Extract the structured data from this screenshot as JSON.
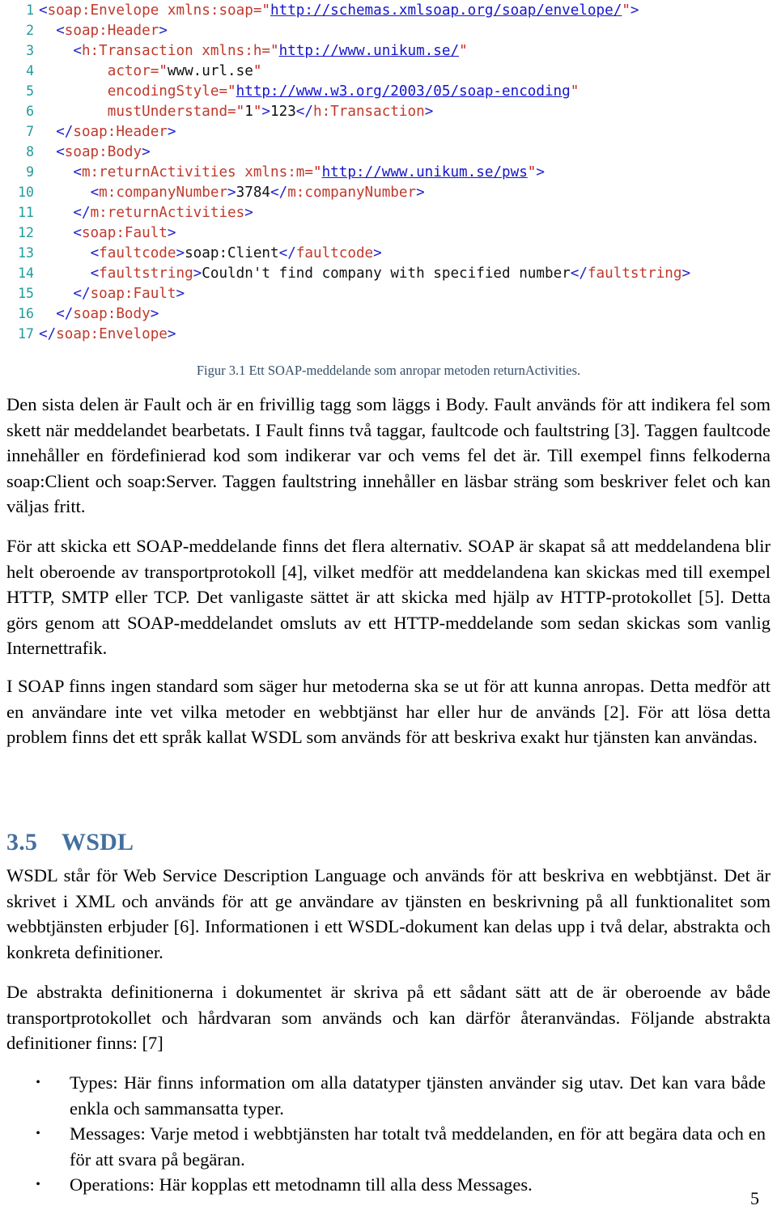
{
  "page": {
    "number": "5",
    "language": "sv"
  },
  "code_listing": {
    "name": "soap-message-example",
    "language": "xml",
    "lines": [
      {
        "n": "1",
        "indent": 0,
        "tokens": [
          {
            "t": "br",
            "v": "<"
          },
          {
            "t": "tag",
            "v": "soap:Envelope"
          },
          {
            "t": "txt",
            "v": " "
          },
          {
            "t": "tag",
            "v": "xmlns:soap"
          },
          {
            "t": "eq",
            "v": "="
          },
          {
            "t": "q",
            "v": "\""
          },
          {
            "t": "url",
            "v": "http://schemas.xmlsoap.org/soap/envelope/"
          },
          {
            "t": "q",
            "v": "\""
          },
          {
            "t": "br",
            "v": ">"
          }
        ]
      },
      {
        "n": "2",
        "indent": 1,
        "tokens": [
          {
            "t": "br",
            "v": "<"
          },
          {
            "t": "tag",
            "v": "soap:Header"
          },
          {
            "t": "br",
            "v": ">"
          }
        ]
      },
      {
        "n": "3",
        "indent": 2,
        "tokens": [
          {
            "t": "br",
            "v": "<"
          },
          {
            "t": "tag",
            "v": "h:Transaction"
          },
          {
            "t": "txt",
            "v": " "
          },
          {
            "t": "tag",
            "v": "xmlns:h"
          },
          {
            "t": "eq",
            "v": "="
          },
          {
            "t": "q",
            "v": "\""
          },
          {
            "t": "url",
            "v": "http://www.unikum.se/"
          },
          {
            "t": "q",
            "v": "\""
          }
        ]
      },
      {
        "n": "4",
        "indent": 4,
        "tokens": [
          {
            "t": "tag",
            "v": "actor"
          },
          {
            "t": "eq",
            "v": "="
          },
          {
            "t": "q",
            "v": "\""
          },
          {
            "t": "txt",
            "v": "www.url.se"
          },
          {
            "t": "q",
            "v": "\""
          }
        ]
      },
      {
        "n": "5",
        "indent": 4,
        "tokens": [
          {
            "t": "tag",
            "v": "encodingStyle"
          },
          {
            "t": "eq",
            "v": "="
          },
          {
            "t": "q",
            "v": "\""
          },
          {
            "t": "url",
            "v": "http://www.w3.org/2003/05/soap-encoding"
          },
          {
            "t": "q",
            "v": "\""
          }
        ]
      },
      {
        "n": "6",
        "indent": 4,
        "tokens": [
          {
            "t": "tag",
            "v": "mustUnderstand"
          },
          {
            "t": "eq",
            "v": "="
          },
          {
            "t": "q",
            "v": "\""
          },
          {
            "t": "txt",
            "v": "1"
          },
          {
            "t": "q",
            "v": "\""
          },
          {
            "t": "br",
            "v": ">"
          },
          {
            "t": "txt",
            "v": "123"
          },
          {
            "t": "br",
            "v": "</"
          },
          {
            "t": "tag",
            "v": "h:Transaction"
          },
          {
            "t": "br",
            "v": ">"
          }
        ]
      },
      {
        "n": "7",
        "indent": 1,
        "tokens": [
          {
            "t": "br",
            "v": "</"
          },
          {
            "t": "tag",
            "v": "soap:Header"
          },
          {
            "t": "br",
            "v": ">"
          }
        ]
      },
      {
        "n": "8",
        "indent": 1,
        "tokens": [
          {
            "t": "br",
            "v": "<"
          },
          {
            "t": "tag",
            "v": "soap:Body"
          },
          {
            "t": "br",
            "v": ">"
          }
        ]
      },
      {
        "n": "9",
        "indent": 2,
        "tokens": [
          {
            "t": "br",
            "v": "<"
          },
          {
            "t": "tag",
            "v": "m:returnActivities"
          },
          {
            "t": "txt",
            "v": " "
          },
          {
            "t": "tag",
            "v": "xmlns:m"
          },
          {
            "t": "eq",
            "v": "="
          },
          {
            "t": "q",
            "v": "\""
          },
          {
            "t": "url",
            "v": "http://www.unikum.se/pws"
          },
          {
            "t": "q",
            "v": "\""
          },
          {
            "t": "br",
            "v": ">"
          }
        ]
      },
      {
        "n": "10",
        "indent": 3,
        "tokens": [
          {
            "t": "br",
            "v": "<"
          },
          {
            "t": "tag",
            "v": "m:companyNumber"
          },
          {
            "t": "br",
            "v": ">"
          },
          {
            "t": "txt",
            "v": "3784"
          },
          {
            "t": "br",
            "v": "</"
          },
          {
            "t": "tag",
            "v": "m:companyNumber"
          },
          {
            "t": "br",
            "v": ">"
          }
        ]
      },
      {
        "n": "11",
        "indent": 2,
        "tokens": [
          {
            "t": "br",
            "v": "</"
          },
          {
            "t": "tag",
            "v": "m:returnActivities"
          },
          {
            "t": "br",
            "v": ">"
          }
        ]
      },
      {
        "n": "12",
        "indent": 2,
        "tokens": [
          {
            "t": "br",
            "v": "<"
          },
          {
            "t": "tag",
            "v": "soap:Fault"
          },
          {
            "t": "br",
            "v": ">"
          }
        ]
      },
      {
        "n": "13",
        "indent": 3,
        "tokens": [
          {
            "t": "br",
            "v": "<"
          },
          {
            "t": "tag",
            "v": "faultcode"
          },
          {
            "t": "br",
            "v": ">"
          },
          {
            "t": "txt",
            "v": "soap:Client"
          },
          {
            "t": "br",
            "v": "</"
          },
          {
            "t": "tag",
            "v": "faultcode"
          },
          {
            "t": "br",
            "v": ">"
          }
        ]
      },
      {
        "n": "14",
        "indent": 3,
        "tokens": [
          {
            "t": "br",
            "v": "<"
          },
          {
            "t": "tag",
            "v": "faultstring"
          },
          {
            "t": "br",
            "v": ">"
          },
          {
            "t": "txt",
            "v": "Couldn't find company with specified number"
          },
          {
            "t": "br",
            "v": "</"
          },
          {
            "t": "tag",
            "v": "faultstring"
          },
          {
            "t": "br",
            "v": ">"
          }
        ]
      },
      {
        "n": "15",
        "indent": 2,
        "tokens": [
          {
            "t": "br",
            "v": "</"
          },
          {
            "t": "tag",
            "v": "soap:Fault"
          },
          {
            "t": "br",
            "v": ">"
          }
        ]
      },
      {
        "n": "16",
        "indent": 1,
        "tokens": [
          {
            "t": "br",
            "v": "</"
          },
          {
            "t": "tag",
            "v": "soap:Body"
          },
          {
            "t": "br",
            "v": ">"
          }
        ]
      },
      {
        "n": "17",
        "indent": 0,
        "tokens": [
          {
            "t": "br",
            "v": "</"
          },
          {
            "t": "tag",
            "v": "soap:Envelope"
          },
          {
            "t": "br",
            "v": ">"
          }
        ]
      }
    ]
  },
  "figure": {
    "caption": "Figur 3.1 Ett SOAP-meddelande som anropar metoden returnActivities."
  },
  "paragraphs": {
    "fault": "Den sista delen är Fault och är en frivillig tagg som läggs i Body. Fault används för att indikera fel som skett när meddelandet bearbetats. I Fault finns två taggar, faultcode och faultstring [3]. Taggen faultcode innehåller en fördefinierad kod som indikerar var och vems fel det är. Till exempel finns felkoderna soap:Client och soap:Server. Taggen faultstring innehåller en läsbar sträng som beskriver felet och kan väljas fritt.",
    "sending": "För att skicka ett SOAP-meddelande finns det flera alternativ. SOAP är skapat så att meddelandena blir helt oberoende av transportprotokoll [4], vilket medför att meddelandena kan skickas med till exempel HTTP, SMTP eller TCP. Det vanligaste sättet är att skicka med hjälp av HTTP-protokollet [5]. Detta görs genom att SOAP-meddelandet omsluts av ett HTTP-meddelande som sedan skickas som vanlig Internettrafik.",
    "no_standard": "I SOAP finns ingen standard som säger hur metoderna ska se ut för att kunna anropas. Detta medför att en användare inte vet vilka metoder en webbtjänst har eller hur de används [2]. För att lösa detta problem finns det ett språk kallat WSDL som används för att beskriva exakt hur tjänsten kan användas.",
    "wsdl_intro": "WSDL står för Web Service Description Language och används för att beskriva en webbtjänst. Det är skrivet i XML och används för att ge användare av tjänsten en beskrivning på all funktionalitet som webbtjänsten erbjuder [6]. Informationen i ett WSDL-dokument kan delas upp i två delar, abstrakta och konkreta definitioner.",
    "abstract_defs": "De abstrakta definitionerna i dokumentet är skriva på ett sådant sätt att de är oberoende av både transportprotokollet och hårdvaran som används och kan därför återanvändas.  Följande abstrakta definitioner finns: [7]"
  },
  "section": {
    "number": "3.5",
    "title": "WSDL"
  },
  "bullets": [
    {
      "label": "Types",
      "text": "Types: Här finns information om alla datatyper tjänsten använder sig utav. Det kan vara både enkla och sammansatta typer."
    },
    {
      "label": "Messages",
      "text": "Messages: Varje metod i webbtjänsten har totalt två meddelanden, en för att begära data och en för att svara på begäran."
    },
    {
      "label": "Operations",
      "text": "Operations: Här kopplas ett metodnamn till alla dess Messages."
    }
  ],
  "bullet_marker": "•",
  "colors": {
    "heading": "#44709e",
    "caption": "#35506b",
    "code_linenumber": "#1f9b9b",
    "code_bracket": "#2222cc",
    "code_tag": "#c0392b",
    "code_url": "#1515cc",
    "code_text": "#111111"
  }
}
